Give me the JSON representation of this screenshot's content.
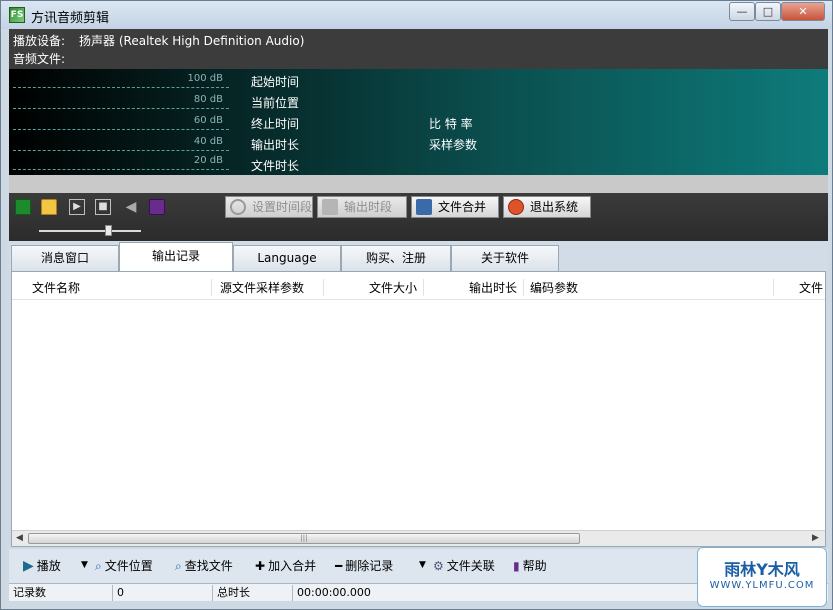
{
  "window": {
    "title": "方讯音频剪辑",
    "app_icon_text": "FS",
    "minimize": "—",
    "maximize": "□",
    "close": "✕"
  },
  "info": {
    "device_label": "播放设备:",
    "device_value": "扬声器 (Realtek High Definition Audio)",
    "file_label": "音频文件:"
  },
  "meter": {
    "db_levels": [
      "100 dB",
      "80 dB",
      "60 dB",
      "40 dB",
      "20 dB"
    ],
    "labels_left": [
      "起始时间",
      "当前位置",
      "终止时间",
      "输出时长",
      "文件时长"
    ],
    "labels_right": [
      "比 特 率",
      "采样参数"
    ]
  },
  "toolbar": {
    "set_period": "设置时间段",
    "output_period": "输出时段",
    "merge_files": "文件合并",
    "exit": "退出系统",
    "play_glyph": "▶",
    "stop_glyph": "■",
    "volume_glyph": "◀"
  },
  "tabs": [
    "消息窗口",
    "输出记录",
    "Language",
    "购买、注册",
    "关于软件"
  ],
  "table": {
    "columns": [
      "文件名称",
      "源文件采样参数",
      "文件大小",
      "输出时长",
      "编码参数",
      "文件"
    ],
    "scroll_grip": "|||",
    "scroll_left": "◀",
    "scroll_right": "▶"
  },
  "actions": {
    "play": "播放",
    "play_dropdown": "▼",
    "file_location": "文件位置",
    "find_file": "查找文件",
    "add_merge": "加入合并",
    "delete_record": "删除记录",
    "delete_dropdown": "▼",
    "file_assoc": "文件关联",
    "help": "帮助"
  },
  "status": {
    "record_count_label": "记录数",
    "record_count_value": "0",
    "total_duration_label": "总时长",
    "total_duration_value": "00:00:00.000"
  },
  "watermark": {
    "main": "雨林Y木风",
    "sub": "WWW.YLMFU.COM"
  }
}
